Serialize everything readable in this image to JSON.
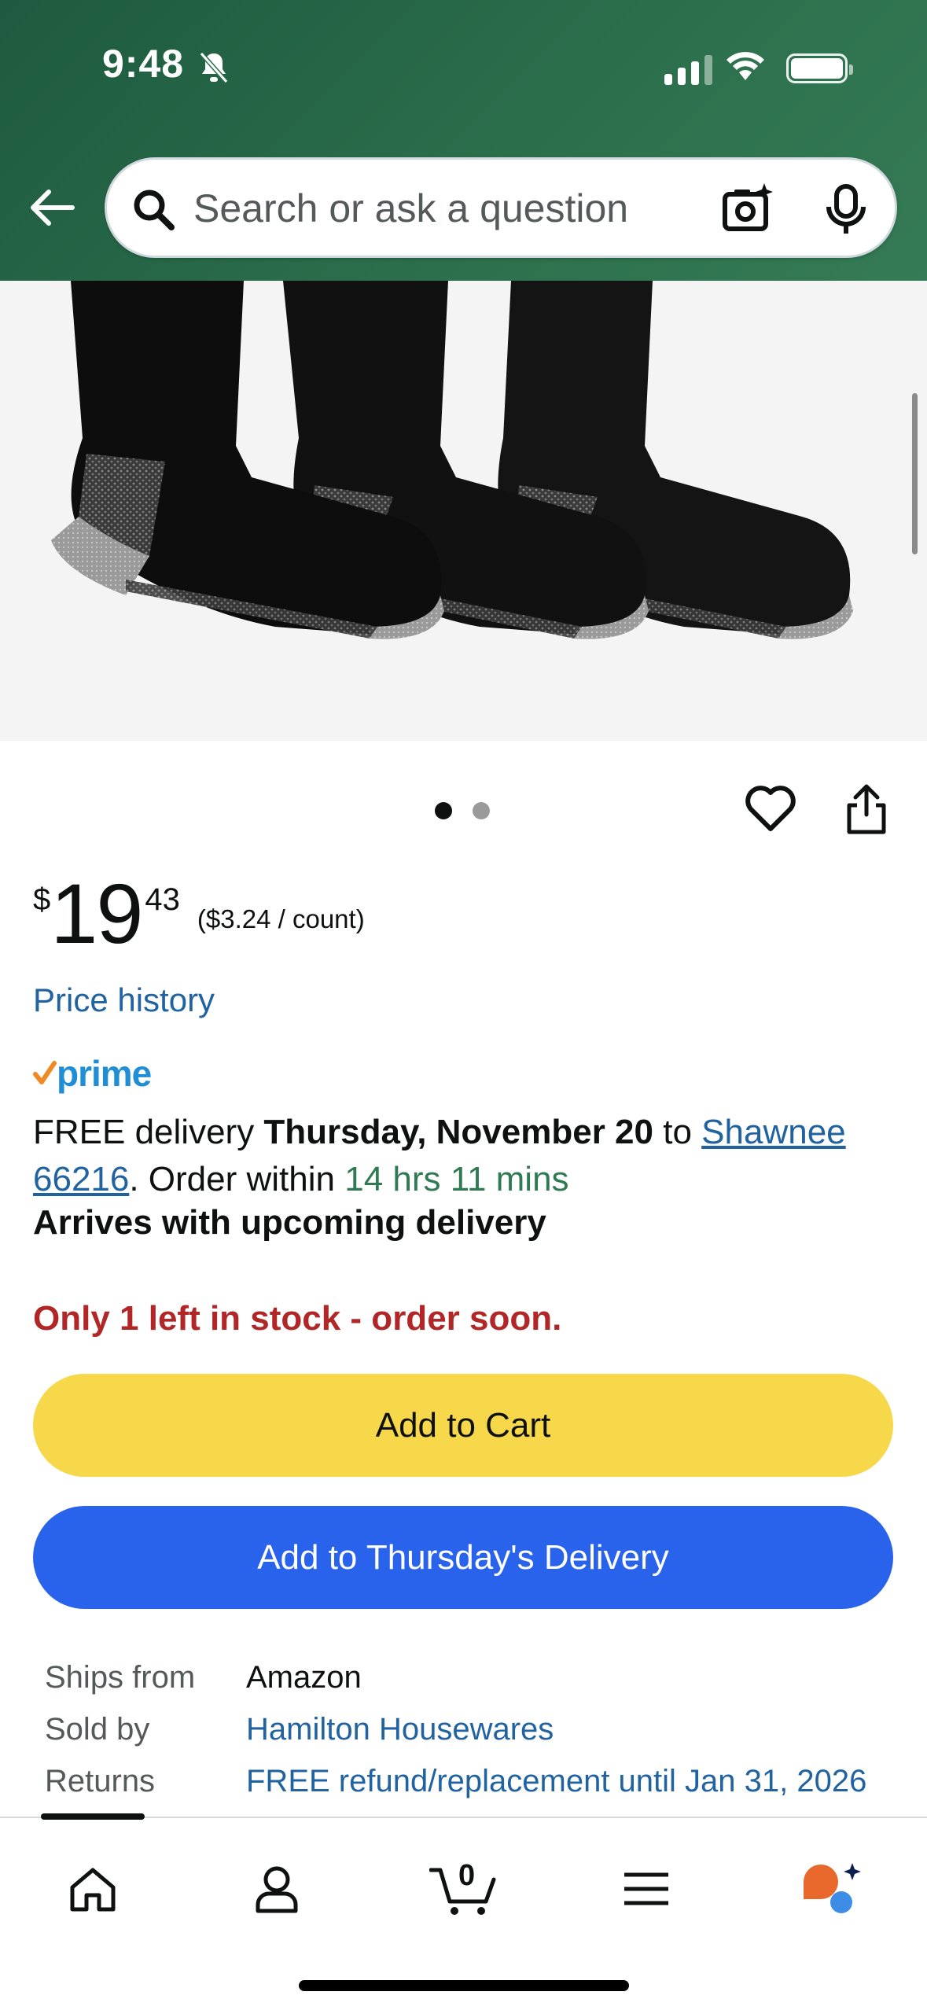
{
  "status_bar": {
    "time": "9:48"
  },
  "search": {
    "placeholder": "Search or ask a question"
  },
  "product": {
    "image_pages": 2,
    "current_image": 1,
    "price": {
      "currency": "$",
      "whole": "19",
      "fraction": "43",
      "unit_price": "($3.24 / count)"
    },
    "price_history_label": "Price history",
    "prime_label": "prime",
    "delivery": {
      "prefix": "FREE delivery ",
      "date": "Thursday, November 20",
      "to": " to ",
      "location": "Shawnee 66216",
      "order_within": ". Order within ",
      "countdown": "14 hrs 11 mins",
      "arrives": "Arrives with upcoming delivery"
    },
    "stock_message": "Only 1 left in stock - order soon.",
    "add_to_cart_label": "Add to Cart",
    "add_to_delivery_label": "Add to Thursday's Delivery",
    "details": [
      {
        "label": "Ships from",
        "value": "Amazon"
      },
      {
        "label": "Sold by",
        "value": "Hamilton Housewares"
      },
      {
        "label": "Returns",
        "value": "FREE refund/replacement until Jan 31, 2026"
      }
    ]
  },
  "bottom_nav": {
    "cart_count": "0"
  },
  "colors": {
    "header_green": "#2b6e4c",
    "link_blue": "#2162a1",
    "cart_yellow": "#f6d84a",
    "delivery_blue": "#2a63eb",
    "stock_red": "#b12727",
    "timer_green": "#2f7a52"
  },
  "icons": [
    "bell-slash-icon",
    "signal-icon",
    "wifi-icon",
    "battery-icon",
    "back-arrow-icon",
    "search-icon",
    "camera-lens-icon",
    "microphone-icon",
    "heart-icon",
    "share-icon",
    "prime-check-icon",
    "home-icon",
    "account-icon",
    "cart-icon",
    "menu-icon",
    "rufus-ai-icon"
  ]
}
